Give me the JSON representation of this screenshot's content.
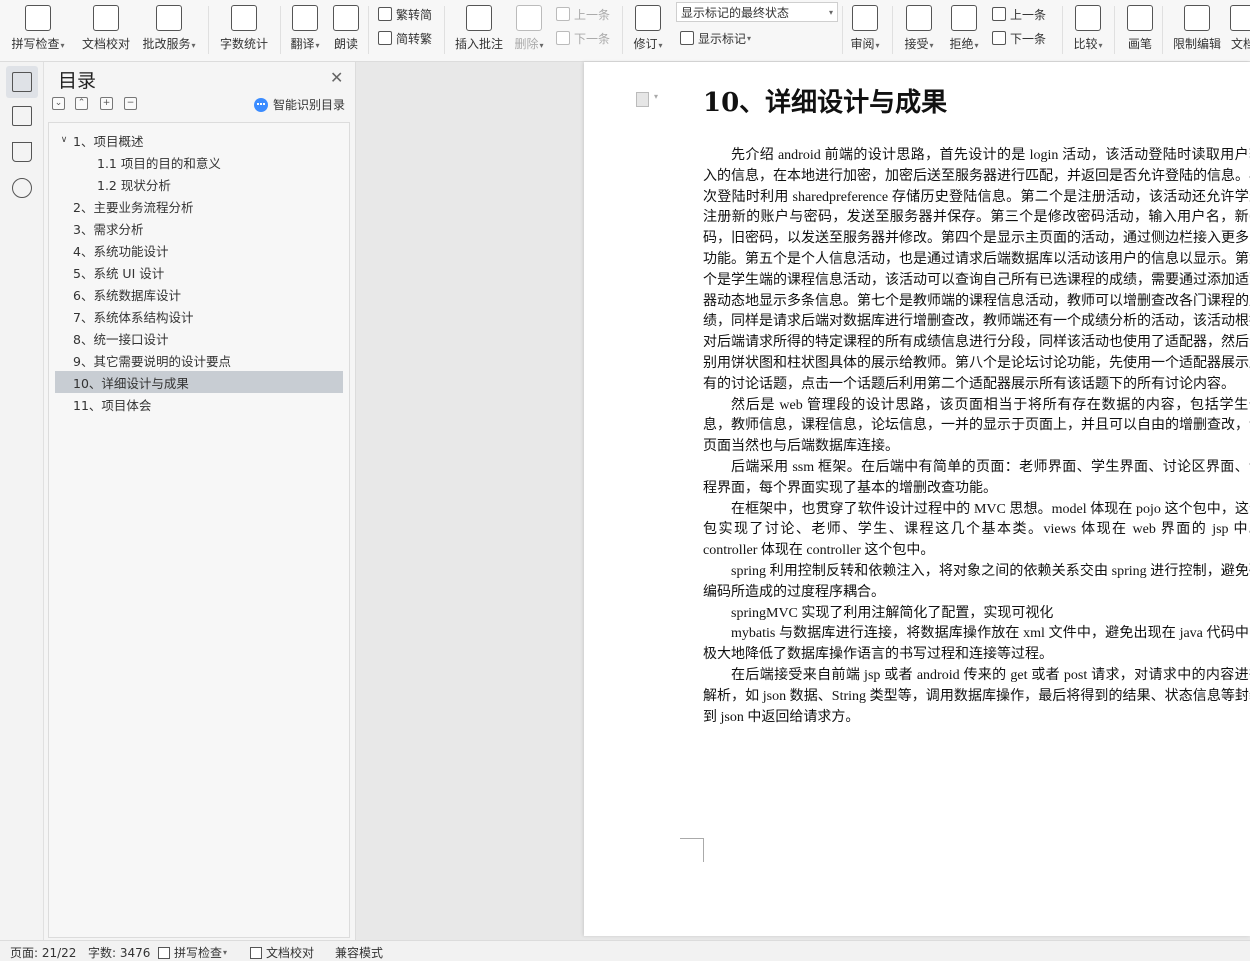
{
  "ribbon": {
    "buttons": [
      {
        "id": "spell",
        "label": "拼写检查",
        "icon": "abc-check-icon",
        "dropdown": true
      },
      {
        "id": "proof",
        "label": "文档校对",
        "icon": "doc-proof-icon",
        "dropdown": false
      },
      {
        "id": "correct",
        "label": "批改服务",
        "icon": "doc-correct-icon",
        "dropdown": true
      },
      {
        "id": "wordcount",
        "label": "字数统计",
        "icon": "word-count-icon",
        "dropdown": false
      },
      {
        "id": "translate",
        "label": "翻译",
        "icon": "translate-icon",
        "dropdown": true
      },
      {
        "id": "read",
        "label": "朗读",
        "icon": "read-aloud-icon",
        "dropdown": false
      },
      {
        "id": "comment",
        "label": "插入批注",
        "icon": "comment-add-icon",
        "dropdown": false
      },
      {
        "id": "delete",
        "label": "删除",
        "icon": "comment-delete-icon",
        "dropdown": true,
        "disabled": true
      },
      {
        "id": "revise",
        "label": "修订",
        "icon": "track-changes-icon",
        "dropdown": true
      },
      {
        "id": "review",
        "label": "审阅",
        "icon": "review-pane-icon",
        "dropdown": true
      },
      {
        "id": "accept",
        "label": "接受",
        "icon": "accept-icon",
        "dropdown": true
      },
      {
        "id": "reject",
        "label": "拒绝",
        "icon": "reject-icon",
        "dropdown": true
      },
      {
        "id": "compare",
        "label": "比较",
        "icon": "compare-icon",
        "dropdown": true
      },
      {
        "id": "pen",
        "label": "画笔",
        "icon": "pen-icon",
        "dropdown": false
      },
      {
        "id": "restrict",
        "label": "限制编辑",
        "icon": "lock-doc-icon",
        "dropdown": false
      },
      {
        "id": "more",
        "label": "文档",
        "icon": "doc-icon",
        "dropdown": false
      }
    ],
    "small": {
      "trad_simp": "繁转简",
      "simp_trad": "简转繁",
      "prev_comment": "上一条",
      "next_comment": "下一条",
      "show_markup": "显示标记",
      "prev_change": "上一条",
      "next_change": "下一条"
    },
    "markup_select": "显示标记的最终状态"
  },
  "toc": {
    "title": "目录",
    "smart_label": "智能识别目录",
    "items": [
      {
        "label": "1、项目概述",
        "level": 1,
        "expanded": true
      },
      {
        "label": "1.1  项目的目的和意义",
        "level": 2
      },
      {
        "label": "1.2  现状分析",
        "level": 2
      },
      {
        "label": "2、主要业务流程分析",
        "level": 1
      },
      {
        "label": "3、需求分析",
        "level": 1
      },
      {
        "label": "4、系统功能设计",
        "level": 1
      },
      {
        "label": "5、系统 UI 设计",
        "level": 1
      },
      {
        "label": "6、系统数据库设计",
        "level": 1
      },
      {
        "label": "7、系统体系结构设计",
        "level": 1
      },
      {
        "label": "8、统一接口设计",
        "level": 1
      },
      {
        "label": "9、其它需要说明的设计要点",
        "level": 1
      },
      {
        "label": "10、详细设计与成果",
        "level": 1,
        "selected": true
      },
      {
        "label": "11、项目体会",
        "level": 1
      }
    ]
  },
  "document": {
    "heading": "10、详细设计与成果",
    "paragraphs": [
      "先介绍 android 前端的设计思路，首先设计的是 login 活动，该活动登陆时读取用户输入的信息，在本地进行加密，加密后送至服务器进行匹配，并返回是否允许登陆的信息。再次登陆时利用 sharedpreference 存储历史登陆信息。第二个是注册活动，该活动还允许学生注册新的账户与密码，发送至服务器并保存。第三个是修改密码活动，输入用户名，新密码，旧密码，以发送至服务器并修改。第四个是显示主页面的活动，通过侧边栏接入更多的功能。第五个是个人信息活动，也是通过请求后端数据库以活动该用户的信息以显示。第六个是学生端的课程信息活动，该活动可以查询自己所有已选课程的成绩，需要通过添加适配器动态地显示多条信息。第七个是教师端的课程信息活动，教师可以增删查改各门课程的成绩，同样是请求后端对数据库进行增删查改，教师端还有一个成绩分析的活动，该活动根据对后端请求所得的特定课程的所有成绩信息进行分段，同样该活动也使用了适配器，然后分别用饼状图和柱状图具体的展示给教师。第八个是论坛讨论功能，先使用一个适配器展示所有的讨论话题，点击一个话题后利用第二个适配器展示所有该话题下的所有讨论内容。",
      "然后是 web 管理段的设计思路，该页面相当于将所有存在数据的内容，包括学生信息，教师信息，课程信息，论坛信息，一并的显示于页面上，并且可以自由的增删查改，该页面当然也与后端数据库连接。",
      "后端采用 ssm 框架。在后端中有简单的页面：老师界面、学生界面、讨论区界面、课程界面，每个界面实现了基本的增删改查功能。",
      "在框架中，也贯穿了软件设计过程中的 MVC 思想。model 体现在 pojo 这个包中，这个包实现了讨论、老师、学生、课程这几个基本类。views 体现在 web 界面的 jsp 中。controller 体现在 controller 这个包中。",
      "spring 利用控制反转和依赖注入，将对象之间的依赖关系交由 spring 进行控制，避免硬编码所造成的过度程序耦合。",
      "springMVC 实现了利用注解简化了配置，实现可视化",
      "mybatis 与数据库进行连接，将数据库操作放在 xml 文件中，避免出现在 java 代码中，极大地降低了数据库操作语言的书写过程和连接等过程。",
      "在后端接受来自前端 jsp 或者 android 传来的 get 或者 post 请求，对请求中的内容进行解析，如 json 数据、String 类型等，调用数据库操作，最后将得到的结果、状态信息等封装到 json 中返回给请求方。"
    ]
  },
  "status": {
    "page": "页面: 21/22",
    "words": "字数: 3476",
    "spell": "拼写检查",
    "proof": "文档校对",
    "compat": "兼容模式"
  }
}
